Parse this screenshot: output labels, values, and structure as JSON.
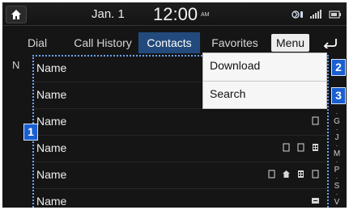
{
  "status": {
    "date": "Jan. 1",
    "time": "12:00",
    "ampm": "AM"
  },
  "tabs": [
    {
      "label": "Dial"
    },
    {
      "label": "Call History"
    },
    {
      "label": "Contacts",
      "active": true
    },
    {
      "label": "Favorites"
    }
  ],
  "menu_label": "Menu",
  "section_letter": "N",
  "contacts": [
    {
      "name": "Name",
      "icons": []
    },
    {
      "name": "Name",
      "icons": []
    },
    {
      "name": "Name",
      "icons": [
        "phone"
      ]
    },
    {
      "name": "Name",
      "icons": [
        "phone",
        "phone",
        "office"
      ]
    },
    {
      "name": "Name",
      "icons": [
        "phone",
        "home",
        "office",
        "phone"
      ]
    },
    {
      "name": "Name",
      "icons": [
        "other"
      ]
    }
  ],
  "dropdown": {
    "items": [
      "Download",
      "Search"
    ]
  },
  "callouts": [
    "1",
    "2",
    "3"
  ],
  "alpha_index": [
    "G",
    "J",
    "M",
    "P",
    "S",
    "V"
  ],
  "colors": {
    "active_tab": "#234a7c",
    "callout": "#1a5fd0",
    "dotted_outline": "#6aa5ff"
  }
}
